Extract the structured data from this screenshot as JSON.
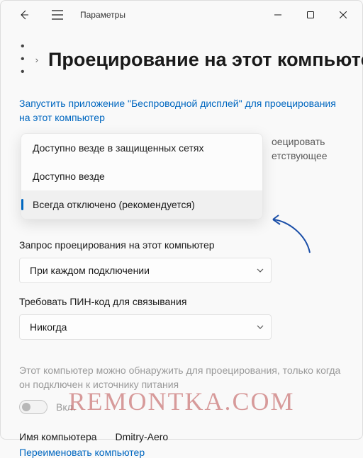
{
  "titlebar": {
    "app_title": "Параметры"
  },
  "breadcrumb": {
    "ellipsis": "• • •",
    "chevron": "›",
    "title": "Проецирование на этот компьютер"
  },
  "link_launch": "Запустить приложение \"Беспроводной дисплей\" для проецирования на этот компьютер",
  "dropdown1": {
    "behind_text": "оецировать етствующее",
    "options": [
      "Доступно везде в защищенных сетях",
      "Доступно везде",
      "Всегда отключено (рекомендуется)"
    ],
    "selected_index": 2
  },
  "section_request": {
    "label": "Запрос проецирования на этот компьютер",
    "value": "При каждом подключении"
  },
  "section_pin": {
    "label": "Требовать ПИН-код для связывания",
    "value": "Никогда"
  },
  "disabled_note": "Этот компьютер можно обнаружить для проецирования, только когда он подключен к источнику питания",
  "toggle": {
    "label": "Вкл."
  },
  "pc_name": {
    "label": "Имя компьютера",
    "value": "Dmitry-Aero"
  },
  "rename_link": "Переименовать компьютер",
  "watermark": "REMONTKA.COM"
}
